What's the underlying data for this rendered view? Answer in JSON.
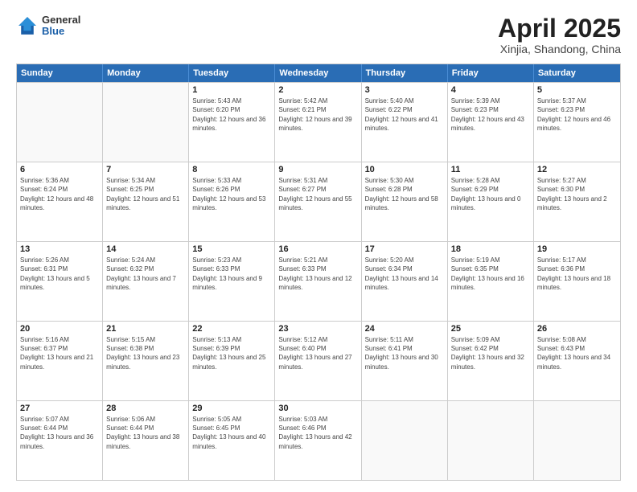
{
  "header": {
    "logo": {
      "line1": "General",
      "line2": "Blue"
    },
    "title": "April 2025",
    "subtitle": "Xinjia, Shandong, China"
  },
  "weekdays": [
    "Sunday",
    "Monday",
    "Tuesday",
    "Wednesday",
    "Thursday",
    "Friday",
    "Saturday"
  ],
  "weeks": [
    [
      {
        "day": "",
        "empty": true
      },
      {
        "day": "",
        "empty": true
      },
      {
        "day": "1",
        "sunrise": "5:43 AM",
        "sunset": "6:20 PM",
        "daylight": "12 hours and 36 minutes."
      },
      {
        "day": "2",
        "sunrise": "5:42 AM",
        "sunset": "6:21 PM",
        "daylight": "12 hours and 39 minutes."
      },
      {
        "day": "3",
        "sunrise": "5:40 AM",
        "sunset": "6:22 PM",
        "daylight": "12 hours and 41 minutes."
      },
      {
        "day": "4",
        "sunrise": "5:39 AM",
        "sunset": "6:23 PM",
        "daylight": "12 hours and 43 minutes."
      },
      {
        "day": "5",
        "sunrise": "5:37 AM",
        "sunset": "6:23 PM",
        "daylight": "12 hours and 46 minutes."
      }
    ],
    [
      {
        "day": "6",
        "sunrise": "5:36 AM",
        "sunset": "6:24 PM",
        "daylight": "12 hours and 48 minutes."
      },
      {
        "day": "7",
        "sunrise": "5:34 AM",
        "sunset": "6:25 PM",
        "daylight": "12 hours and 51 minutes."
      },
      {
        "day": "8",
        "sunrise": "5:33 AM",
        "sunset": "6:26 PM",
        "daylight": "12 hours and 53 minutes."
      },
      {
        "day": "9",
        "sunrise": "5:31 AM",
        "sunset": "6:27 PM",
        "daylight": "12 hours and 55 minutes."
      },
      {
        "day": "10",
        "sunrise": "5:30 AM",
        "sunset": "6:28 PM",
        "daylight": "12 hours and 58 minutes."
      },
      {
        "day": "11",
        "sunrise": "5:28 AM",
        "sunset": "6:29 PM",
        "daylight": "13 hours and 0 minutes."
      },
      {
        "day": "12",
        "sunrise": "5:27 AM",
        "sunset": "6:30 PM",
        "daylight": "13 hours and 2 minutes."
      }
    ],
    [
      {
        "day": "13",
        "sunrise": "5:26 AM",
        "sunset": "6:31 PM",
        "daylight": "13 hours and 5 minutes."
      },
      {
        "day": "14",
        "sunrise": "5:24 AM",
        "sunset": "6:32 PM",
        "daylight": "13 hours and 7 minutes."
      },
      {
        "day": "15",
        "sunrise": "5:23 AM",
        "sunset": "6:33 PM",
        "daylight": "13 hours and 9 minutes."
      },
      {
        "day": "16",
        "sunrise": "5:21 AM",
        "sunset": "6:33 PM",
        "daylight": "13 hours and 12 minutes."
      },
      {
        "day": "17",
        "sunrise": "5:20 AM",
        "sunset": "6:34 PM",
        "daylight": "13 hours and 14 minutes."
      },
      {
        "day": "18",
        "sunrise": "5:19 AM",
        "sunset": "6:35 PM",
        "daylight": "13 hours and 16 minutes."
      },
      {
        "day": "19",
        "sunrise": "5:17 AM",
        "sunset": "6:36 PM",
        "daylight": "13 hours and 18 minutes."
      }
    ],
    [
      {
        "day": "20",
        "sunrise": "5:16 AM",
        "sunset": "6:37 PM",
        "daylight": "13 hours and 21 minutes."
      },
      {
        "day": "21",
        "sunrise": "5:15 AM",
        "sunset": "6:38 PM",
        "daylight": "13 hours and 23 minutes."
      },
      {
        "day": "22",
        "sunrise": "5:13 AM",
        "sunset": "6:39 PM",
        "daylight": "13 hours and 25 minutes."
      },
      {
        "day": "23",
        "sunrise": "5:12 AM",
        "sunset": "6:40 PM",
        "daylight": "13 hours and 27 minutes."
      },
      {
        "day": "24",
        "sunrise": "5:11 AM",
        "sunset": "6:41 PM",
        "daylight": "13 hours and 30 minutes."
      },
      {
        "day": "25",
        "sunrise": "5:09 AM",
        "sunset": "6:42 PM",
        "daylight": "13 hours and 32 minutes."
      },
      {
        "day": "26",
        "sunrise": "5:08 AM",
        "sunset": "6:43 PM",
        "daylight": "13 hours and 34 minutes."
      }
    ],
    [
      {
        "day": "27",
        "sunrise": "5:07 AM",
        "sunset": "6:44 PM",
        "daylight": "13 hours and 36 minutes."
      },
      {
        "day": "28",
        "sunrise": "5:06 AM",
        "sunset": "6:44 PM",
        "daylight": "13 hours and 38 minutes."
      },
      {
        "day": "29",
        "sunrise": "5:05 AM",
        "sunset": "6:45 PM",
        "daylight": "13 hours and 40 minutes."
      },
      {
        "day": "30",
        "sunrise": "5:03 AM",
        "sunset": "6:46 PM",
        "daylight": "13 hours and 42 minutes."
      },
      {
        "day": "",
        "empty": true
      },
      {
        "day": "",
        "empty": true
      },
      {
        "day": "",
        "empty": true
      }
    ]
  ],
  "labels": {
    "sunrise": "Sunrise:",
    "sunset": "Sunset:",
    "daylight": "Daylight:"
  }
}
